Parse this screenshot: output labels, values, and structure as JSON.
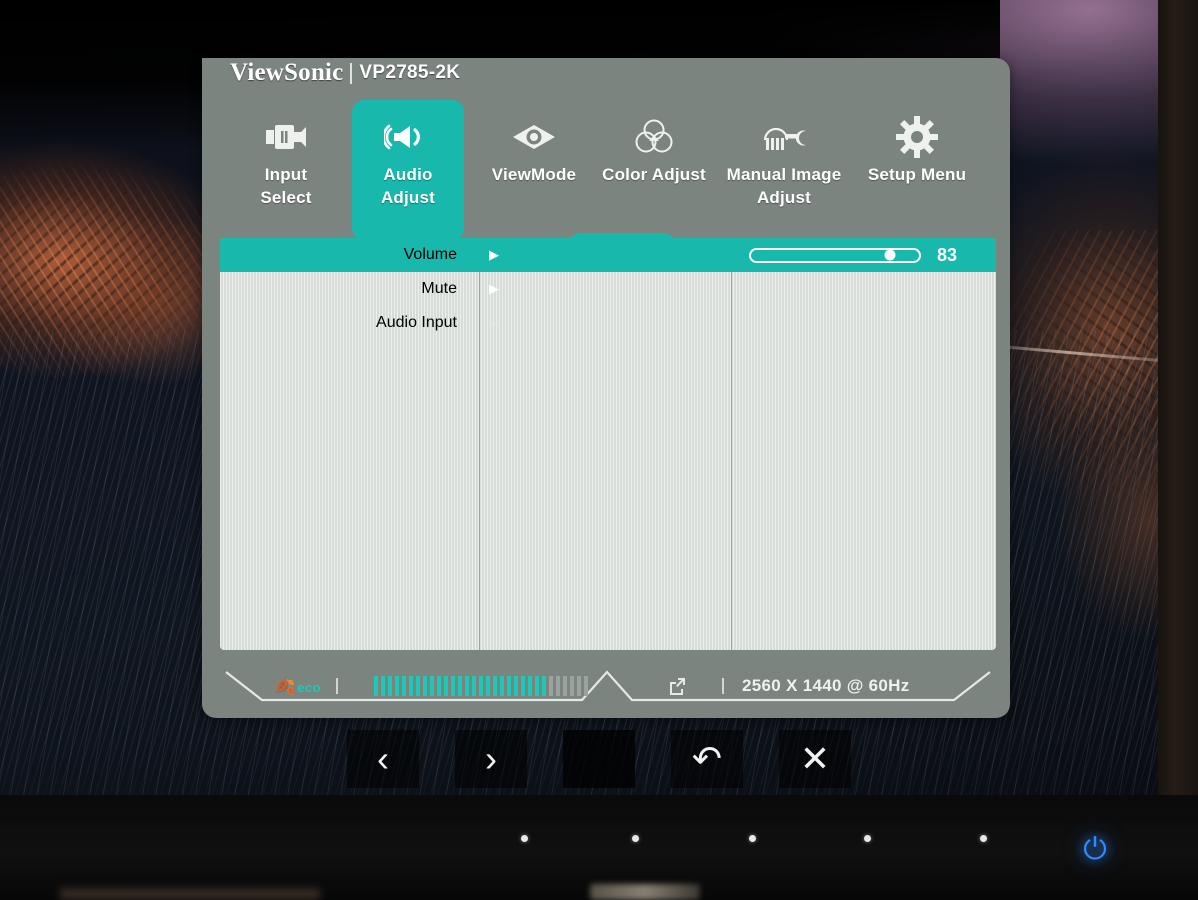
{
  "brand": {
    "name": "ViewSonic",
    "model": "VP2785-2K"
  },
  "tabs": [
    {
      "id": "input-select",
      "label": "Input\nSelect",
      "icon": "input-connector-icon",
      "active": false
    },
    {
      "id": "audio-adjust",
      "label": "Audio Adjust",
      "icon": "speaker-waves-icon",
      "active": true
    },
    {
      "id": "viewmode",
      "label": "ViewMode",
      "icon": "eye-icon",
      "active": false
    },
    {
      "id": "color-adjust",
      "label": "Color Adjust",
      "icon": "color-circles-icon",
      "active": false
    },
    {
      "id": "manual-image-adjust",
      "label": "Manual Image\nAdjust",
      "icon": "sliders-wrench-icon",
      "active": false
    },
    {
      "id": "setup-menu",
      "label": "Setup Menu",
      "icon": "gear-icon",
      "active": false
    }
  ],
  "menu": {
    "items": [
      {
        "label": "Volume",
        "arrow": "▶",
        "state": "selected",
        "value": "83",
        "slider_percent": 83
      },
      {
        "label": "Mute",
        "arrow": "▶",
        "state": "normal"
      },
      {
        "label": "Audio Input",
        "arrow": "▶",
        "state": "disabled"
      }
    ]
  },
  "status": {
    "eco_label": "eco",
    "eco_icon": "leaf-icon",
    "meter_total": 31,
    "meter_filled": 25,
    "input_icon": "external-input-icon",
    "resolution": "2560 X 1440 @ 60Hz"
  },
  "keys": [
    {
      "id": "prev",
      "glyph": "‹",
      "name": "previous-button"
    },
    {
      "id": "next",
      "glyph": "›",
      "name": "next-button"
    },
    {
      "id": "blank",
      "glyph": "",
      "name": "blank-button"
    },
    {
      "id": "back",
      "glyph": "↶",
      "name": "back-button"
    },
    {
      "id": "exit",
      "glyph": "✕",
      "name": "exit-button"
    }
  ],
  "bezel": {
    "indicator_count": 5,
    "power_glyph": "⏻"
  },
  "colors": {
    "accent": "#18b8ad",
    "osd_bg": "#7c8480",
    "panel_bg": "#d6dcd7",
    "eco": "#1ec8b6",
    "power_led": "#2f8bff"
  }
}
